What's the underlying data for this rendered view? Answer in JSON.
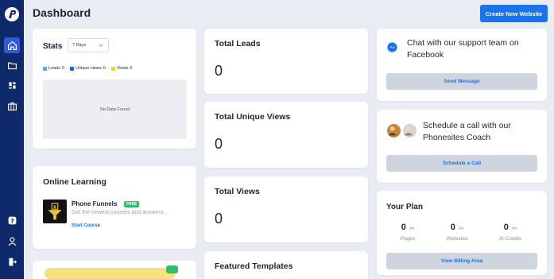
{
  "page": {
    "title": "Dashboard",
    "create_button": "Create New Website"
  },
  "sidebar": {
    "logo": "p-logo-icon",
    "top_items": [
      {
        "icon": "home-icon",
        "active": true
      },
      {
        "icon": "folder-icon",
        "active": false
      },
      {
        "icon": "grid-icon",
        "active": false
      },
      {
        "icon": "briefcase-icon",
        "active": false
      }
    ],
    "bottom_items": [
      {
        "icon": "help-icon"
      },
      {
        "icon": "user-icon"
      },
      {
        "icon": "logout-icon"
      }
    ]
  },
  "stats": {
    "title": "Stats",
    "range": "7 Days",
    "legend": [
      {
        "label": "Leads",
        "count": "0",
        "color": "#5aa9e6"
      },
      {
        "label": "Unique views",
        "count": "0",
        "color": "#1a5fd0"
      },
      {
        "label": "Views",
        "count": "0",
        "color": "#f2cf4a"
      }
    ],
    "empty_text": "No Data Found"
  },
  "online_learning": {
    "title": "Online Learning",
    "course": {
      "name": "Phone Funnels",
      "badge": "FREE",
      "description": "Get the newest courses and answers...",
      "link": "Start Course"
    }
  },
  "metrics": [
    {
      "label": "Total Leads",
      "value": "0"
    },
    {
      "label": "Total Unique Views",
      "value": "0"
    },
    {
      "label": "Total Views",
      "value": "0"
    }
  ],
  "featured": {
    "title": "Featured Templates"
  },
  "support": {
    "text": "Chat with our support team on Facebook",
    "button": "Send Message"
  },
  "coach": {
    "text": "Schedule a call with our Phonesites Coach",
    "button": "Schedule a Call"
  },
  "plan": {
    "title": "Your Plan",
    "stats": [
      {
        "value": "0",
        "unit": "/∞",
        "label": "Pages"
      },
      {
        "value": "0",
        "unit": "/∞",
        "label": "Websites"
      },
      {
        "value": "0",
        "unit": "/∞",
        "label": "AI Credits"
      }
    ],
    "button": "View Billing Area"
  },
  "colors": {
    "sidebar": "#0f2a6b",
    "accent": "#1a73e8",
    "badge": "#2fbf6a"
  }
}
